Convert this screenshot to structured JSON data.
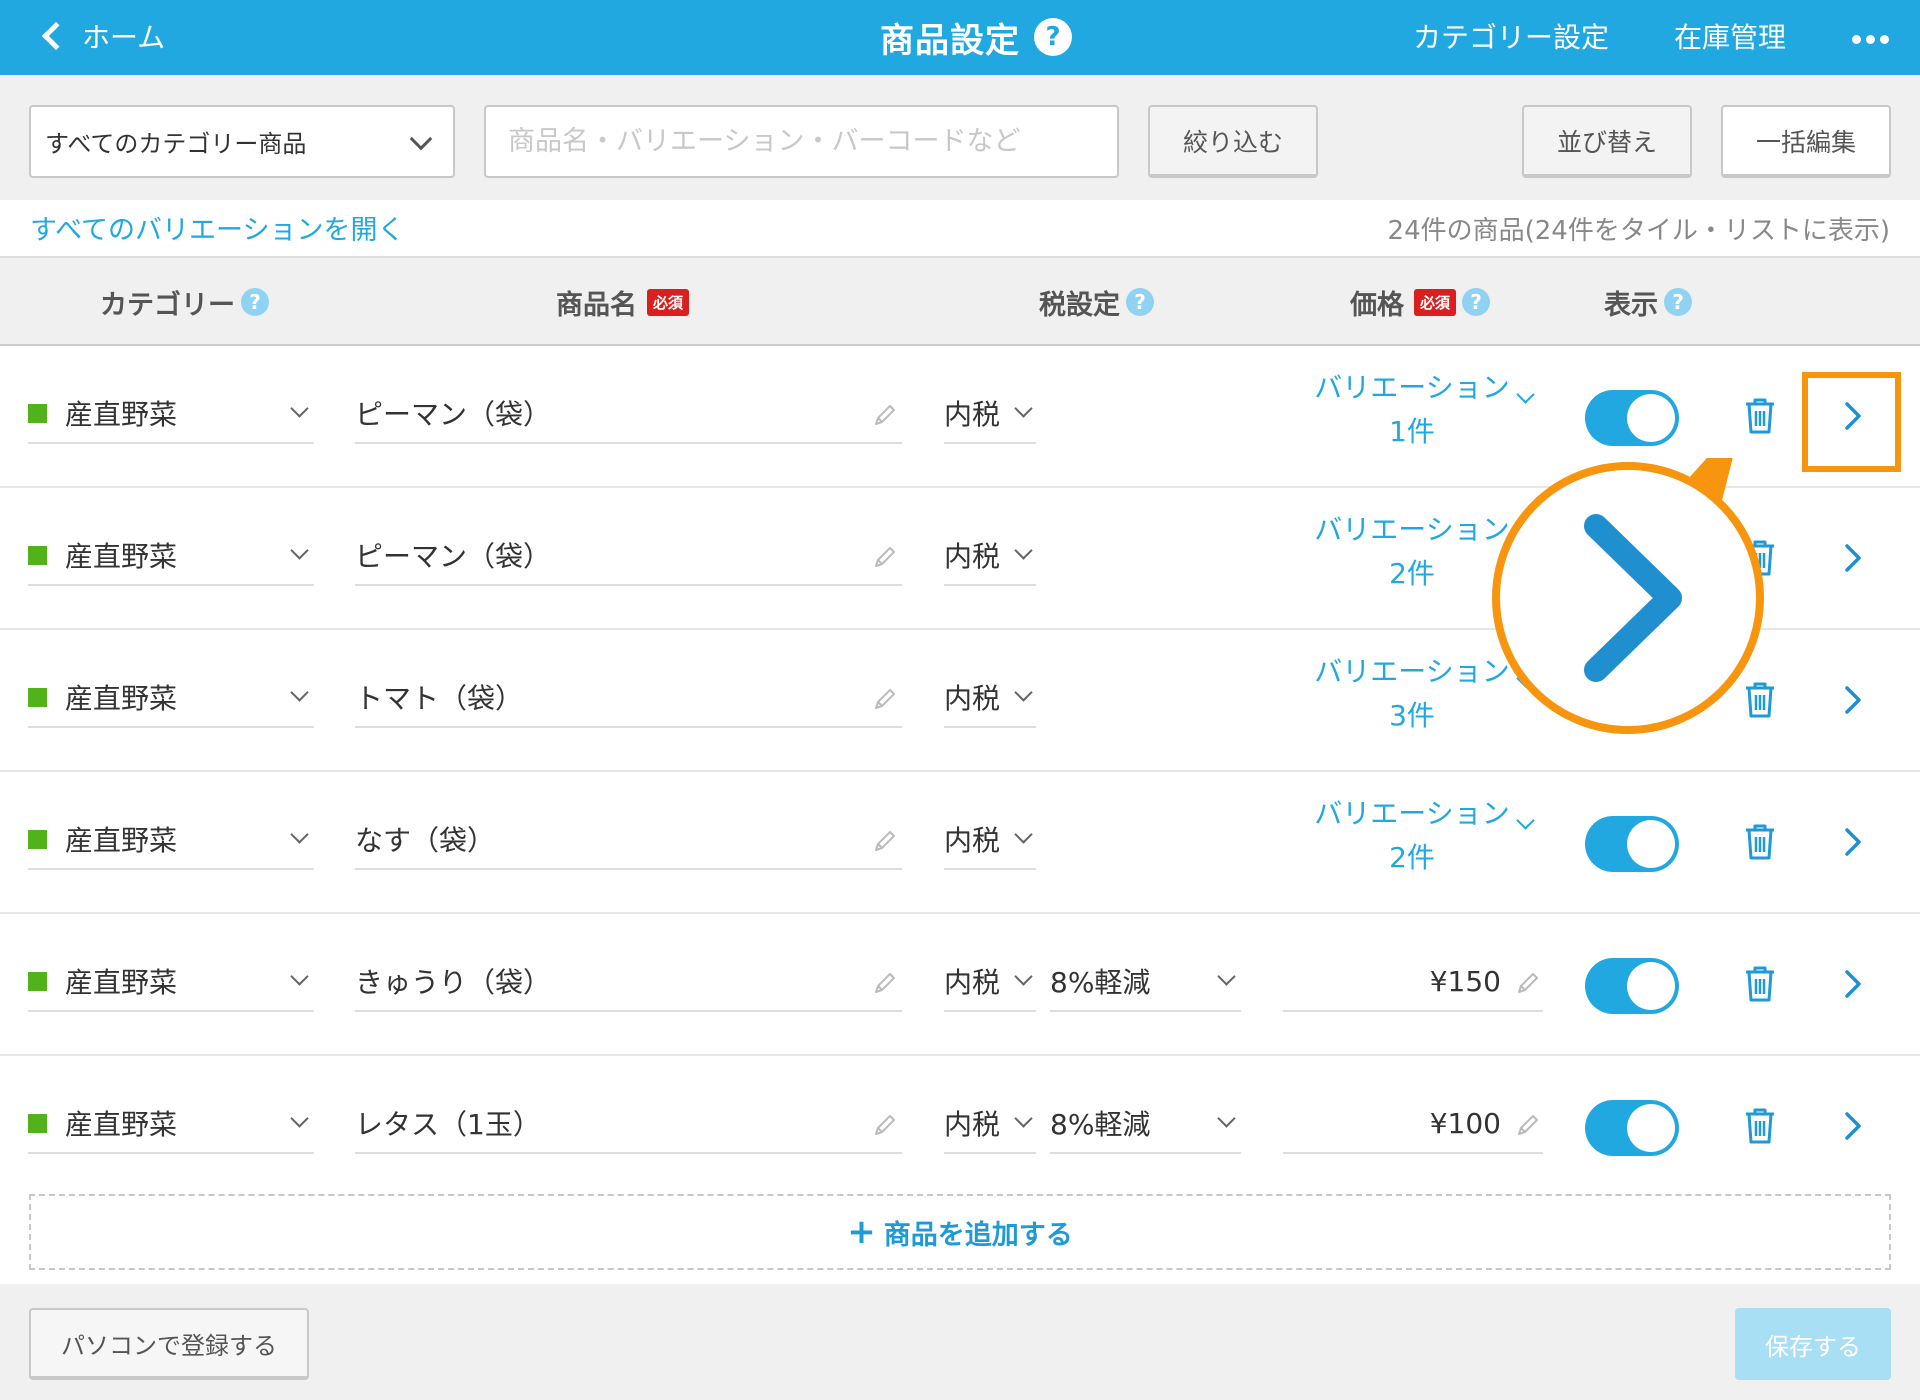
{
  "header": {
    "back_label": "ホーム",
    "title": "商品設定",
    "help_mark": "?",
    "nav_category": "カテゴリー設定",
    "nav_stock": "在庫管理"
  },
  "filter": {
    "category_select": "すべてのカテゴリー商品",
    "search_placeholder": "商品名・バリエーション・バーコードなど",
    "filter_button": "絞り込む",
    "sort_button": "並び替え",
    "bulk_edit_button": "一括編集"
  },
  "info": {
    "expand_all": "すべてのバリエーションを開く",
    "count_text": "24件の商品(24件をタイル・リストに表示)"
  },
  "columns": {
    "category": "カテゴリー",
    "name": "商品名",
    "tax": "税設定",
    "price": "価格",
    "display": "表示",
    "required_badge": "必須"
  },
  "rows": [
    {
      "category": "産直野菜",
      "name": "ピーマン（袋）",
      "tax": "内税",
      "variation_label": "バリエーション",
      "variation_count": "1件",
      "display": true
    },
    {
      "category": "産直野菜",
      "name": "ピーマン（袋）",
      "tax": "内税",
      "variation_label": "バリエーション",
      "variation_count": "2件",
      "display": true
    },
    {
      "category": "産直野菜",
      "name": "トマト（袋）",
      "tax": "内税",
      "variation_label": "バリエーション",
      "variation_count": "3件",
      "display": true
    },
    {
      "category": "産直野菜",
      "name": "なす（袋）",
      "tax": "内税",
      "variation_label": "バリエーション",
      "variation_count": "2件",
      "display": true
    },
    {
      "category": "産直野菜",
      "name": "きゅうり（袋）",
      "tax": "内税",
      "reduced_tax": "8%軽減",
      "price": "¥150",
      "display": true
    },
    {
      "category": "産直野菜",
      "name": "レタス（1玉）",
      "tax": "内税",
      "reduced_tax": "8%軽減",
      "price": "¥100",
      "display": true
    }
  ],
  "add_product": "商品を追加する",
  "footer": {
    "pc_register": "パソコンで登録する",
    "save": "保存する"
  },
  "colors": {
    "brand": "#22a8e0",
    "highlight": "#f7960e",
    "category_marker": "#52b21a",
    "required": "#d9201f"
  },
  "icons": [
    "back-chevron-icon",
    "help-icon",
    "more-icon",
    "chevron-down-icon",
    "pencil-icon",
    "trash-icon",
    "chevron-right-icon"
  ]
}
